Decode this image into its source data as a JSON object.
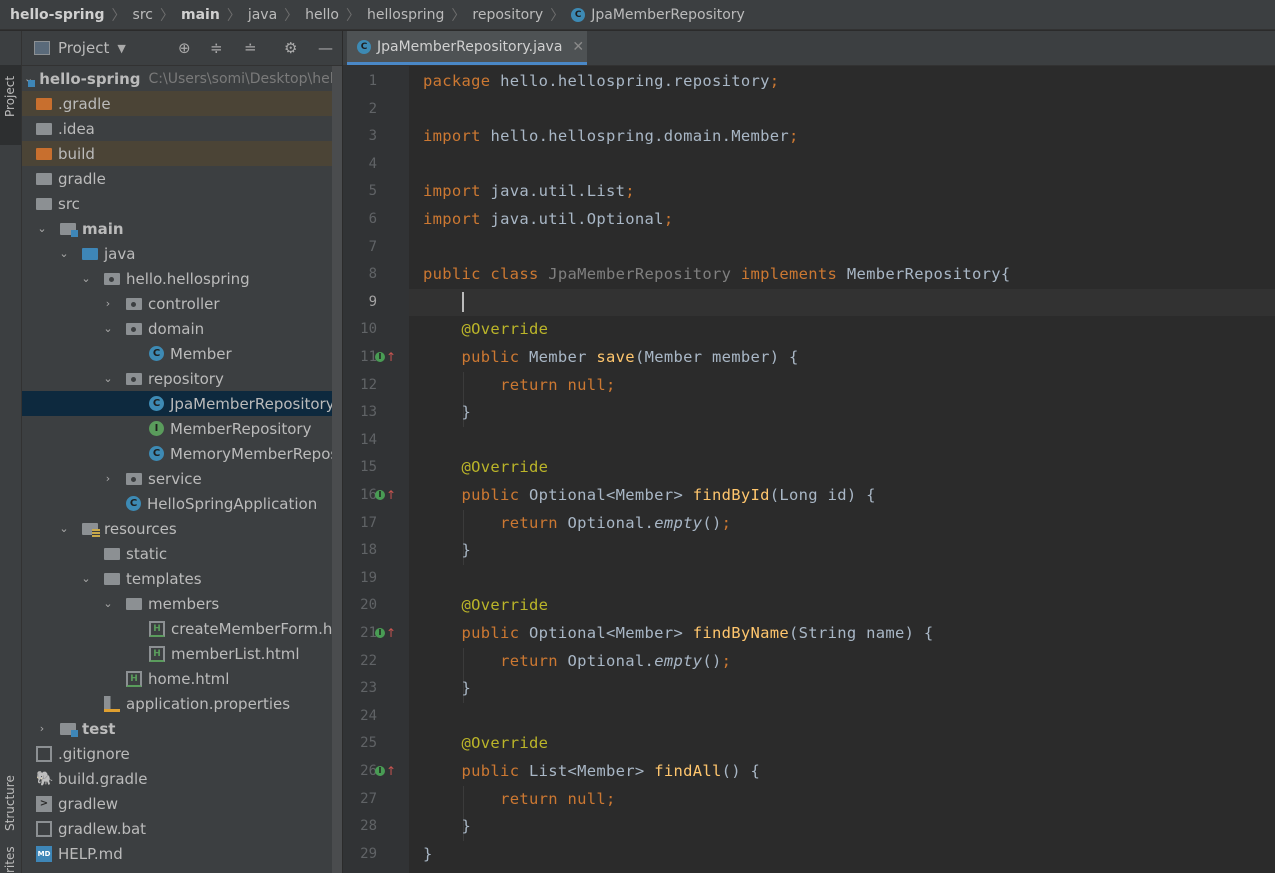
{
  "breadcrumb": [
    "hello-spring",
    "src",
    "main",
    "java",
    "hello",
    "hellospring",
    "repository",
    "JpaMemberRepository"
  ],
  "left_strip": {
    "project_tab": "Project",
    "structure_tab": "Structure",
    "favorites_tab": "rites"
  },
  "project_panel": {
    "title": "Project",
    "tree": [
      {
        "label": "hello-spring",
        "path": "C:\\Users\\somi\\Desktop\\hello"
      },
      {
        "label": ".gradle"
      },
      {
        "label": ".idea"
      },
      {
        "label": "build"
      },
      {
        "label": "gradle"
      },
      {
        "label": "src"
      },
      {
        "label": "main"
      },
      {
        "label": "java"
      },
      {
        "label": "hello.hellospring"
      },
      {
        "label": "controller"
      },
      {
        "label": "domain"
      },
      {
        "label": "Member"
      },
      {
        "label": "repository"
      },
      {
        "label": "JpaMemberRepository"
      },
      {
        "label": "MemberRepository"
      },
      {
        "label": "MemoryMemberRepositor"
      },
      {
        "label": "service"
      },
      {
        "label": "HelloSpringApplication"
      },
      {
        "label": "resources"
      },
      {
        "label": "static"
      },
      {
        "label": "templates"
      },
      {
        "label": "members"
      },
      {
        "label": "createMemberForm.html"
      },
      {
        "label": "memberList.html"
      },
      {
        "label": "home.html"
      },
      {
        "label": "application.properties"
      },
      {
        "label": "test"
      },
      {
        "label": ".gitignore"
      },
      {
        "label": "build.gradle"
      },
      {
        "label": "gradlew"
      },
      {
        "label": "gradlew.bat"
      },
      {
        "label": "HELP.md"
      }
    ]
  },
  "editor": {
    "tab_label": "JpaMemberRepository.java",
    "current_line": 9,
    "lines": [
      [
        {
          "t": "package ",
          "c": "kw"
        },
        {
          "t": "hello.hellospring.repository",
          "c": ""
        },
        {
          "t": ";",
          "c": "kw"
        }
      ],
      [],
      [
        {
          "t": "import ",
          "c": "kw"
        },
        {
          "t": "hello.hellospring.domain.Member",
          "c": ""
        },
        {
          "t": ";",
          "c": "kw"
        }
      ],
      [],
      [
        {
          "t": "import ",
          "c": "kw"
        },
        {
          "t": "java.util.List",
          "c": ""
        },
        {
          "t": ";",
          "c": "kw"
        }
      ],
      [
        {
          "t": "import ",
          "c": "kw"
        },
        {
          "t": "java.util.Optional",
          "c": ""
        },
        {
          "t": ";",
          "c": "kw"
        }
      ],
      [],
      [
        {
          "t": "public class ",
          "c": "kw"
        },
        {
          "t": "JpaMemberRepository ",
          "c": "cn"
        },
        {
          "t": "implements ",
          "c": "kw"
        },
        {
          "t": "MemberRepository{",
          "c": ""
        }
      ],
      [],
      [
        {
          "t": "    ",
          "c": ""
        },
        {
          "t": "@Override",
          "c": "ann"
        }
      ],
      [
        {
          "t": "    ",
          "c": ""
        },
        {
          "t": "public ",
          "c": "kw"
        },
        {
          "t": "Member ",
          "c": ""
        },
        {
          "t": "save",
          "c": "fn"
        },
        {
          "t": "(Member member) {",
          "c": ""
        }
      ],
      [
        {
          "t": "        ",
          "c": ""
        },
        {
          "t": "return null;",
          "c": "kw"
        }
      ],
      [
        {
          "t": "    }",
          "c": ""
        }
      ],
      [],
      [
        {
          "t": "    ",
          "c": ""
        },
        {
          "t": "@Override",
          "c": "ann"
        }
      ],
      [
        {
          "t": "    ",
          "c": ""
        },
        {
          "t": "public ",
          "c": "kw"
        },
        {
          "t": "Optional<Member> ",
          "c": ""
        },
        {
          "t": "findById",
          "c": "fn"
        },
        {
          "t": "(Long id) {",
          "c": ""
        }
      ],
      [
        {
          "t": "        ",
          "c": ""
        },
        {
          "t": "return ",
          "c": "kw"
        },
        {
          "t": "Optional.",
          "c": ""
        },
        {
          "t": "empty",
          "c": "it"
        },
        {
          "t": "()",
          "c": ""
        },
        {
          "t": ";",
          "c": "kw"
        }
      ],
      [
        {
          "t": "    }",
          "c": ""
        }
      ],
      [],
      [
        {
          "t": "    ",
          "c": ""
        },
        {
          "t": "@Override",
          "c": "ann"
        }
      ],
      [
        {
          "t": "    ",
          "c": ""
        },
        {
          "t": "public ",
          "c": "kw"
        },
        {
          "t": "Optional<Member> ",
          "c": ""
        },
        {
          "t": "findByName",
          "c": "fn"
        },
        {
          "t": "(String name) {",
          "c": ""
        }
      ],
      [
        {
          "t": "        ",
          "c": ""
        },
        {
          "t": "return ",
          "c": "kw"
        },
        {
          "t": "Optional.",
          "c": ""
        },
        {
          "t": "empty",
          "c": "it"
        },
        {
          "t": "()",
          "c": ""
        },
        {
          "t": ";",
          "c": "kw"
        }
      ],
      [
        {
          "t": "    }",
          "c": ""
        }
      ],
      [],
      [
        {
          "t": "    ",
          "c": ""
        },
        {
          "t": "@Override",
          "c": "ann"
        }
      ],
      [
        {
          "t": "    ",
          "c": ""
        },
        {
          "t": "public ",
          "c": "kw"
        },
        {
          "t": "List<Member> ",
          "c": ""
        },
        {
          "t": "findAll",
          "c": "fn"
        },
        {
          "t": "() {",
          "c": ""
        }
      ],
      [
        {
          "t": "        ",
          "c": ""
        },
        {
          "t": "return null;",
          "c": "kw"
        }
      ],
      [
        {
          "t": "    }",
          "c": ""
        }
      ],
      [
        {
          "t": "}",
          "c": ""
        }
      ]
    ],
    "line_numbers": [
      "1",
      "2",
      "3",
      "4",
      "5",
      "6",
      "7",
      "8",
      "9",
      "10",
      "11",
      "12",
      "13",
      "14",
      "15",
      "16",
      "17",
      "18",
      "19",
      "20",
      "21",
      "22",
      "23",
      "24",
      "25",
      "26",
      "27",
      "28",
      "29"
    ],
    "implementation_marker_lines": [
      11,
      16,
      21,
      26
    ],
    "fold_marker_lines": [
      3,
      6,
      11,
      13,
      16,
      18,
      21,
      23,
      26,
      28
    ]
  },
  "colors": {
    "keyword": "#cc7832",
    "annotation": "#bbb529",
    "method": "#ffc66d",
    "text": "#a9b7c6",
    "background": "#2b2b2b",
    "selection": "#0d293e"
  }
}
